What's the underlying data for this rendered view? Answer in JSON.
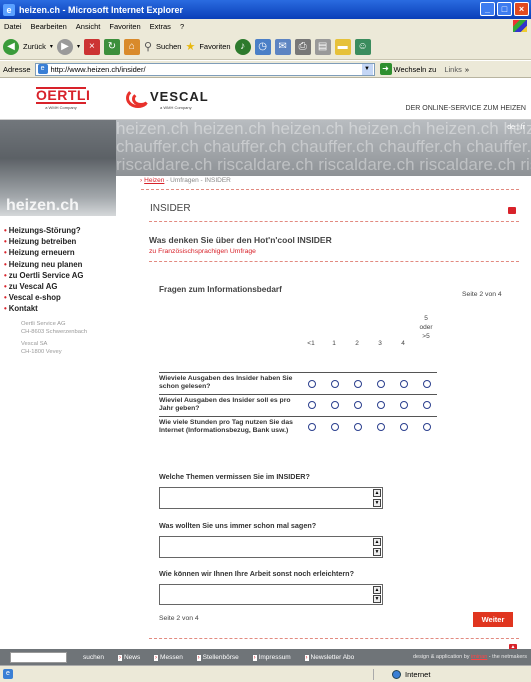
{
  "window": {
    "title": "heizen.ch - Microsoft Internet Explorer"
  },
  "menubar": [
    "Datei",
    "Bearbeiten",
    "Ansicht",
    "Favoriten",
    "Extras",
    "?"
  ],
  "toolbar": {
    "back_label": "Zurück",
    "search_label": "Suchen",
    "favorites_label": "Favoriten"
  },
  "addressbar": {
    "label": "Adresse",
    "url": "http://www.heizen.ch/insider/",
    "go_label": "Wechseln zu",
    "links_label": "Links"
  },
  "header": {
    "oertli_logo": "OERTLI",
    "oertli_sub": "a WMH Company",
    "vescal_logo": "VESCAL",
    "vescal_sub": "a WMH Company",
    "slogan": "DER ONLINE-SERVICE ZUM HEIZEN",
    "lang": "de | fr",
    "banner_lines": [
      "heizen.ch  heizen.ch  heizen.ch  heizen.ch  heizen.ch  heizen.ch",
      "chauffer.ch  chauffer.ch  chauffer.ch  chauffer.ch  chauffer.ch",
      "riscaldare.ch  riscaldare.ch  riscaldare.ch  riscaldare.ch  riscaldare.ch"
    ],
    "site_logo": "heizen.ch"
  },
  "breadcrumb": {
    "home": "Heizen",
    "rest": " - Umfragen - INSIDER"
  },
  "sidebar": {
    "items": [
      "Heizungs-Störung?",
      "Heizung betreiben",
      "Heizung erneuern",
      "Heizung neu planen",
      "zu Oertli Service AG",
      "zu Vescal AG",
      "Vescal e-shop",
      "Kontakt"
    ],
    "address1": [
      "Oertli Service AG",
      "CH-8603 Schwerzenbach"
    ],
    "address2": [
      "Vescal SA",
      "CH-1800 Vevey"
    ]
  },
  "main": {
    "section_title": "INSIDER",
    "question_heading": "Was denken Sie über den Hot'n'cool INSIDER",
    "french_link": "zu Französischsprachigen Umfrage",
    "fragen_title": "Fragen zum Informationsbedarf",
    "page_indicator": "Seite 2 von 4",
    "scale": [
      "<1",
      "1",
      "2",
      "3",
      "4",
      "5\noder\n>5"
    ],
    "questions": [
      "Wieviele Ausgaben des Insider haben Sie schon gelesen?",
      "Wieviel Ausgaben des Insider soll es pro Jahr geben?",
      "Wie viele Stunden pro Tag nutzen Sie das Internet (Informationsbezug, Bank usw.)"
    ],
    "text_questions": [
      "Welche Themen vermissen Sie im INSIDER?",
      "Was wollten Sie uns immer schon mal sagen?",
      "Wie können wir Ihnen Ihre Arbeit sonst noch erleichtern?"
    ],
    "page_indicator_bottom": "Seite 2 von 4",
    "next_button": "Weiter"
  },
  "footer": {
    "search_button": "suchen",
    "nav": [
      "News",
      "Messen",
      "Stellenbörse",
      "Impressum",
      "Newsletter Abo"
    ],
    "credit_prefix": "design & application by ",
    "credit_link": "iminan",
    "credit_suffix": " - the netmakers"
  },
  "statusbar": {
    "zone": "Internet"
  }
}
